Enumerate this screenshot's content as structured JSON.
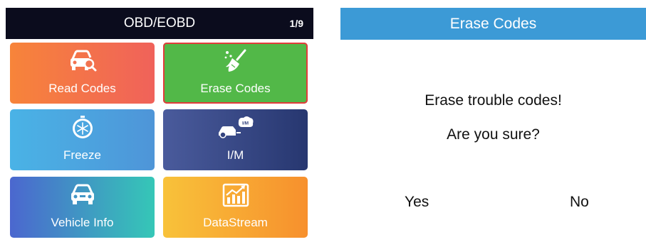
{
  "left_screen": {
    "title": "OBD/EOBD",
    "page_indicator": "1/9",
    "tiles": [
      {
        "label": "Read Codes",
        "icon": "car-search-icon",
        "color": "#f27350"
      },
      {
        "label": "Erase Codes",
        "icon": "broom-icon",
        "color": "#52b848",
        "selected": true
      },
      {
        "label": "Freeze",
        "icon": "freeze-frame-icon",
        "color": "#4ba6e0"
      },
      {
        "label": "I/M",
        "icon": "im-readiness-icon",
        "icon_text": "I/M",
        "color": "#34447f"
      },
      {
        "label": "Vehicle Info",
        "icon": "car-info-icon",
        "color": "#4296c7"
      },
      {
        "label": "DataStream",
        "icon": "chart-trend-icon",
        "color": "#f8a833"
      }
    ]
  },
  "dialog": {
    "title": "Erase Codes",
    "message_line1": "Erase trouble codes!",
    "message_line2": "Are you sure?",
    "yes_label": "Yes",
    "no_label": "No",
    "header_color": "#3c9ad6"
  }
}
